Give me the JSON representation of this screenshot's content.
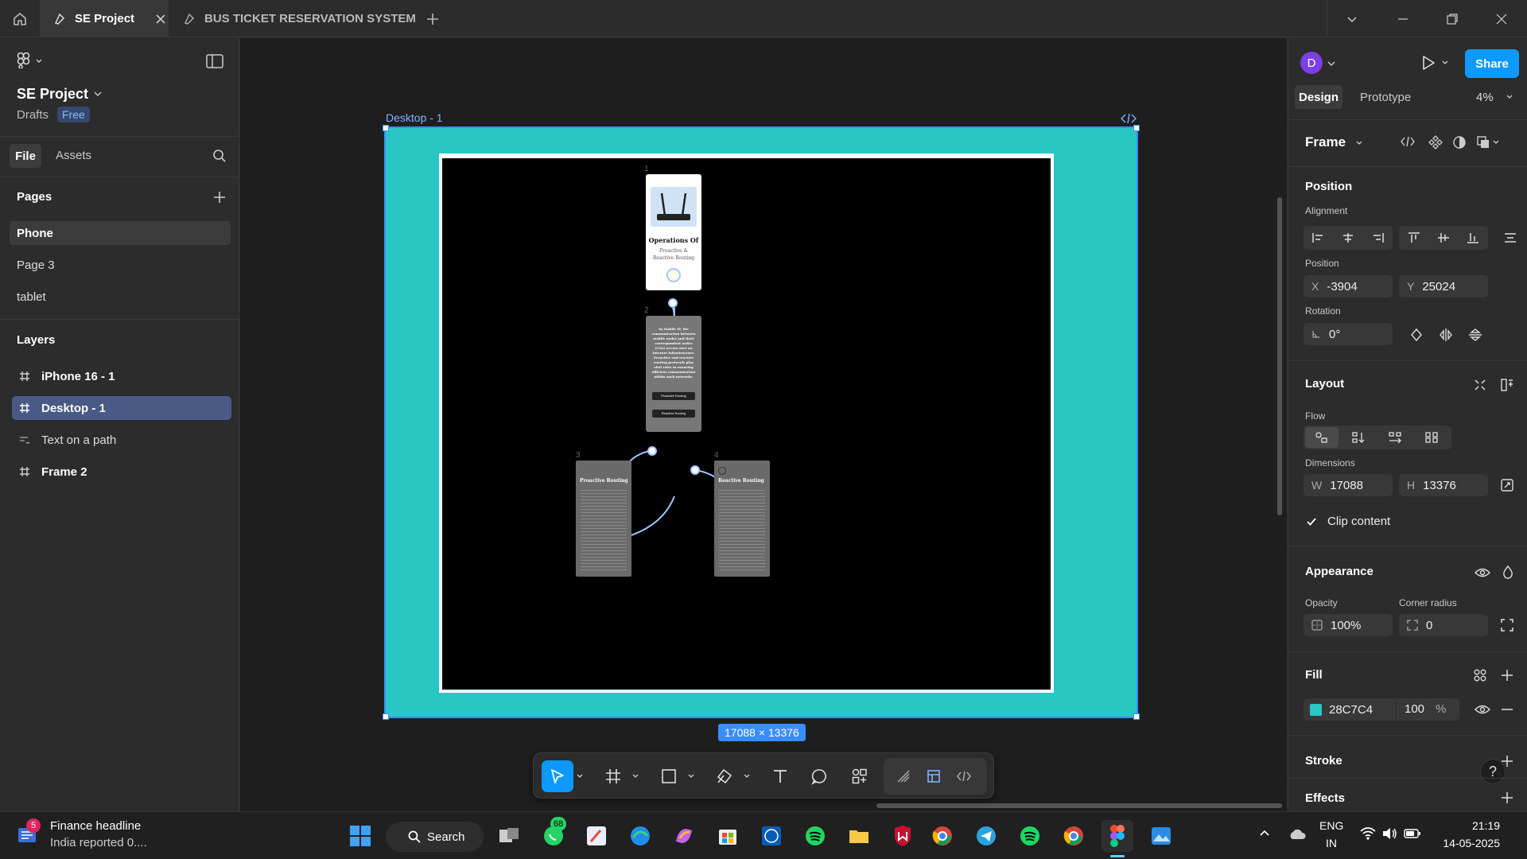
{
  "titlebar": {
    "tabs": [
      {
        "label": "SE Project",
        "active": true
      },
      {
        "label": "BUS TICKET RESERVATION SYSTEM",
        "active": false
      }
    ]
  },
  "left_panel": {
    "project_name": "SE Project",
    "drafts_label": "Drafts",
    "plan_badge": "Free",
    "tabs": [
      "File",
      "Assets"
    ],
    "pages_heading": "Pages",
    "pages": [
      "Phone",
      "Page 3",
      "tablet"
    ],
    "layers_heading": "Layers",
    "layers": [
      {
        "name": "iPhone 16 - 1",
        "icon": "frame-icon"
      },
      {
        "name": "Desktop - 1",
        "icon": "frame-icon"
      },
      {
        "name": "Text on a path",
        "icon": "text-path-icon"
      },
      {
        "name": "Frame 2",
        "icon": "frame-icon"
      }
    ]
  },
  "canvas": {
    "frame_label": "Desktop - 1",
    "size_badge": "17088 × 13376",
    "frame_fill": "#28C7C4",
    "diagram": {
      "card1": {
        "number": "1",
        "title": "Operations Of",
        "subtitle": "Proactive & Reactive Routing"
      },
      "card2": {
        "number": "2",
        "body": "In Mobile IP, the communication between mobile nodes and their correspondent nodes (CNs) occurs over an Internet infrastructure. Proactive and reactive routing protocols play vital roles in ensuring efficient communication within such networks.",
        "btn1": "Proactive Routing",
        "btn2": "Reactive Routing"
      },
      "card3": {
        "number": "3",
        "title": "Proactive Routing"
      },
      "card4": {
        "number": "4",
        "title": "Reactive Routing"
      }
    }
  },
  "right_panel": {
    "avatar_letter": "D",
    "share_label": "Share",
    "tabs": [
      "Design",
      "Prototype"
    ],
    "zoom": "4%",
    "frame_label": "Frame",
    "position_heading": "Position",
    "alignment_label": "Alignment",
    "position_label": "Position",
    "x_key": "X",
    "x_value": "-3904",
    "y_key": "Y",
    "y_value": "25024",
    "rotation_label": "Rotation",
    "rotation_value": "0°",
    "layout_heading": "Layout",
    "flow_label": "Flow",
    "dimensions_label": "Dimensions",
    "w_key": "W",
    "w_value": "17088",
    "h_key": "H",
    "h_value": "13376",
    "clip_content_label": "Clip content",
    "appearance_heading": "Appearance",
    "opacity_label": "Opacity",
    "opacity_value": "100%",
    "corner_radius_label": "Corner radius",
    "corner_radius_value": "0",
    "fill_heading": "Fill",
    "fill_hex": "28C7C4",
    "fill_opacity": "100",
    "fill_percent": "%",
    "stroke_heading": "Stroke",
    "effects_heading": "Effects",
    "help": "?"
  },
  "taskbar": {
    "news_badge": "5",
    "news_title": "Finance headline",
    "news_sub": "India reported 0....",
    "search_label": "Search",
    "whatsapp_badge": "68",
    "lang_top": "ENG",
    "lang_bottom": "IN",
    "time": "21:19",
    "date": "14-05-2025"
  }
}
